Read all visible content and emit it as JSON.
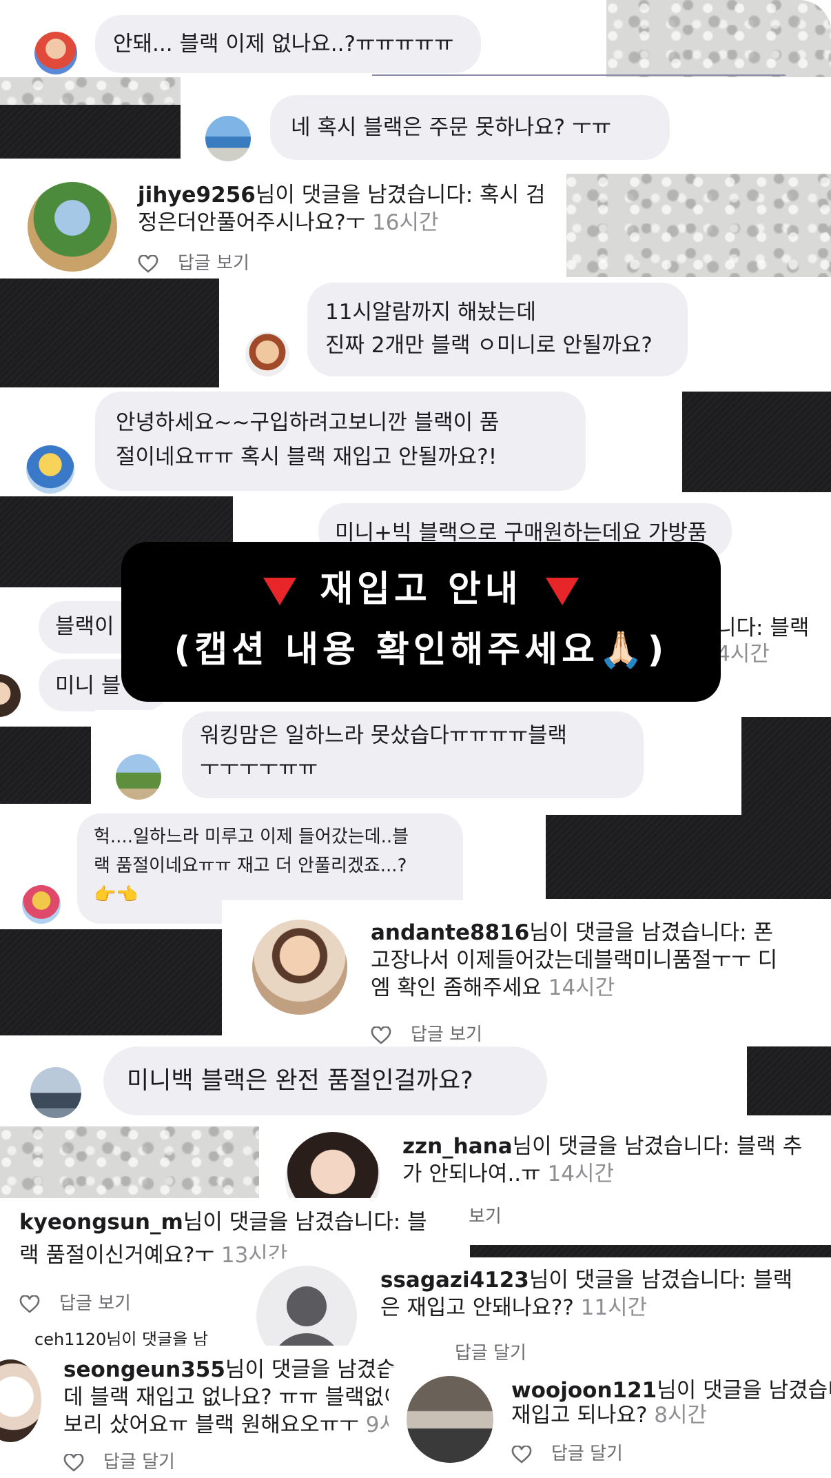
{
  "comments": {
    "c1": "안돼... 블랙 이제 없나요..?ㅠㅠㅠㅠㅠ",
    "c2": "네 혹시 블랙은 주문 못하나요? ㅜㅠ",
    "c3": {
      "user": "jihye9256",
      "suffix": "님이 댓글을 남겼습니다: 혹시 검",
      "line2": "정은더안풀어주시나요?ㅜ",
      "time": "16시간",
      "reply": "답글 보기"
    },
    "c4": {
      "line1": "11시알람까지 해놨는데",
      "line2": "진짜 2개만 블랙 ㅇ미니로 안될까요?"
    },
    "c5": {
      "line1": "안녕하세요~~구입하려고보니깐 블랙이 품",
      "line2": "절이네요ㅠㅠ 혹시 블랙 재입고 안될까요?!"
    },
    "c6": "미니+빅 블랙으로 구매원하는데요 가방품",
    "c7": "블랙이",
    "c8": "미니 블",
    "c9": {
      "suffix": "니다: 블랙",
      "time": "4시간"
    },
    "c10": {
      "line1": "워킹맘은 일하느라 못샀습다ㅠㅠㅠㅠ블랙",
      "line2": "ㅜㅜㅜㅜㅠㅠ"
    },
    "c11": {
      "line1": "헉....일하느라 미루고 이제 들어갔는데..블",
      "line2": "랙 품절이네요ㅠㅠ 재고 더 안풀리겠죠...?",
      "line3": "👉👈"
    },
    "c12": {
      "user": "andante8816",
      "suffix": "님이 댓글을 남겼습니다: 폰",
      "line2": "고장나서 이제들어갔는데블랙미니품절ㅜㅜ 디",
      "line3": "엠 확인 좀해주세요",
      "time": "14시간",
      "reply": "답글 보기"
    },
    "c13": "미니백 블랙은 완전 품절인걸까요?",
    "c14": {
      "user": "zzn_hana",
      "suffix": "님이 댓글을 남겼습니다: 블랙 추",
      "line2": "가 안되나여..ㅠ",
      "time": "14시간",
      "reply": "보기"
    },
    "c15": {
      "user": "kyeongsun_m",
      "suffix": "님이 댓글을 남겼습니다: 블",
      "line2": "랙 품절이신거예요?ㅜ",
      "time": "13시간",
      "reply": "답글 보기"
    },
    "c16": {
      "user": "ssagazi4123",
      "suffix": "님이 댓글을 남겼습니다: 블랙",
      "line2": "은 재입고 안돼나요??",
      "time": "11시간",
      "reply": "답글 달기"
    },
    "c17": {
      "fragment": "ceh1120님이 댓글을 남"
    },
    "c18": {
      "user": "seongeun355",
      "suffix": "님이 댓글을 남겼습",
      "line2": "데 블랙 재입고 없나요? ㅠㅠ 블랙없이",
      "line3": "보리 샀어요ㅠ 블랙 원해요오ㅠㅜ",
      "time": "9시",
      "reply": "답글 달기"
    },
    "c19": {
      "user": "woojoon121",
      "suffix": "님이 댓글을 남겼습니다",
      "line2": "재입고 되나요?",
      "time": "8시간",
      "reply": "답글 달기"
    }
  },
  "banner": {
    "line1": "재입고 안내",
    "line2": "(캡션 내용 확인해주세요🙏🏻)"
  },
  "colors": {
    "bubble": "#efeff3",
    "banner_bg": "#000000",
    "triangle": "#e8262a",
    "time": "#8e8e93"
  },
  "icons": [
    "heart-outline-icon",
    "red-triangle-icon",
    "praying-hands-icon"
  ]
}
